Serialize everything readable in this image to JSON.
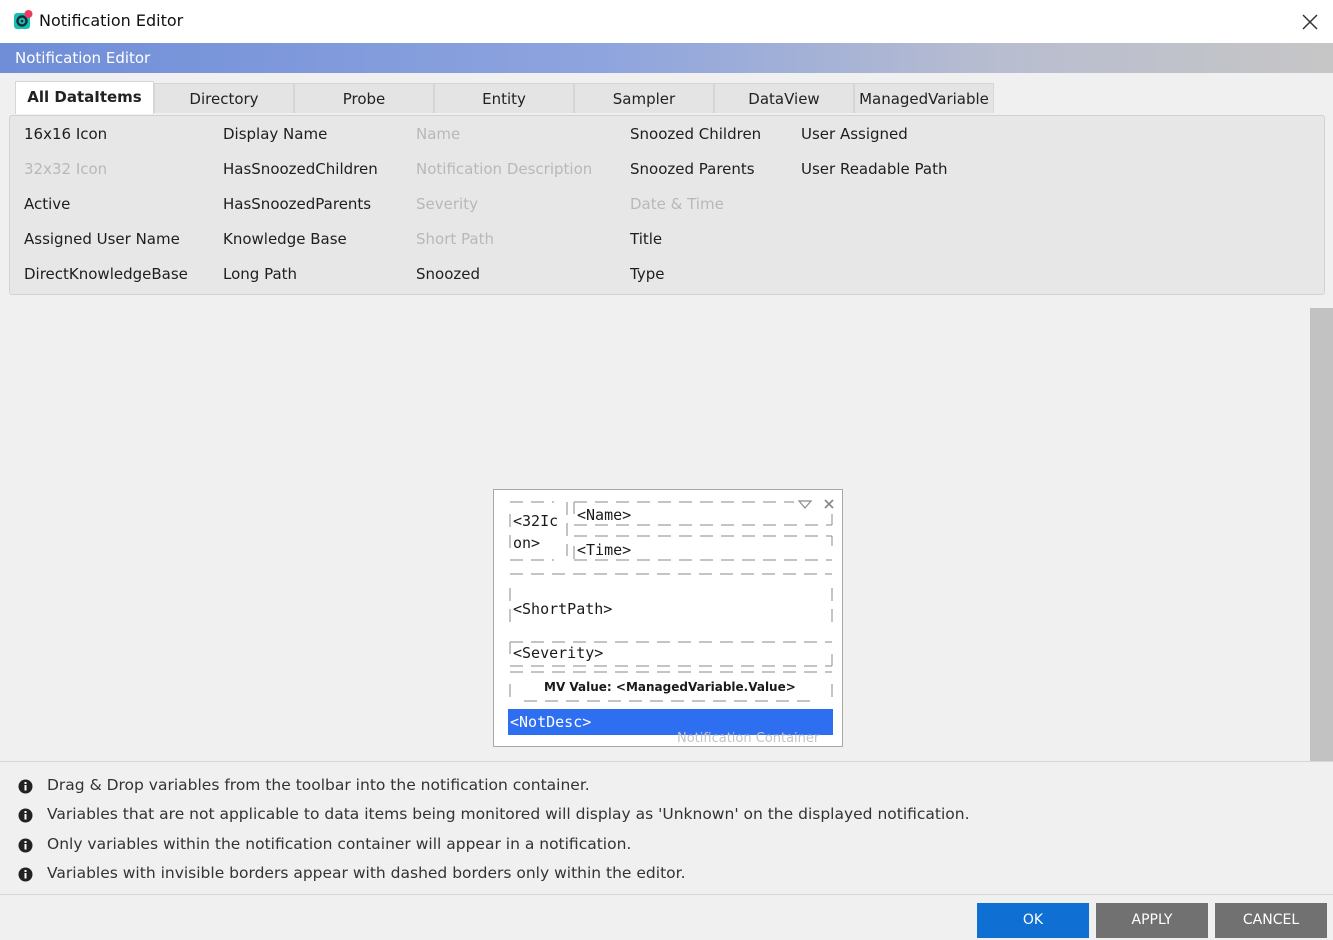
{
  "window": {
    "title": "Notification Editor"
  },
  "header": {
    "title": "Notification Editor"
  },
  "tabs": [
    {
      "label": "All DataItems",
      "active": true
    },
    {
      "label": "Directory"
    },
    {
      "label": "Probe"
    },
    {
      "label": "Entity"
    },
    {
      "label": "Sampler"
    },
    {
      "label": "DataView"
    },
    {
      "label": "ManagedVariable"
    }
  ],
  "items": {
    "col1": [
      "16x16 Icon",
      "32x32 Icon",
      "Active",
      "Assigned User Name",
      "DirectKnowledgeBase"
    ],
    "col2": [
      "Display Name",
      "HasSnoozedChildren",
      "HasSnoozedParents",
      "Knowledge Base",
      "Long Path"
    ],
    "col3": [
      "Name",
      "Notification Description",
      "Severity",
      "Short Path",
      "Snoozed"
    ],
    "col4": [
      "Snoozed Children",
      "Snoozed Parents",
      "Date & Time",
      "Title",
      "Type"
    ],
    "col5": [
      "User Assigned",
      "User Readable Path"
    ],
    "disabled": [
      "32x32 Icon",
      "Name",
      "Notification Description",
      "Severity",
      "Short Path",
      "Date & Time"
    ]
  },
  "container": {
    "label": "Notification Container",
    "icon_l1": "<32Ic",
    "icon_l2": "on>",
    "name": "<Name>",
    "time": "<Time>",
    "shortpath": "<ShortPath>",
    "severity": "<Severity>",
    "mv": "MV Value: <ManagedVariable.Value>",
    "notdesc": "<NotDesc>"
  },
  "info": [
    "Drag & Drop variables from the toolbar into the notification container.",
    "Variables that are not applicable to data items being monitored will display as 'Unknown' on the displayed notification.",
    "Only variables within the notification container will appear in a notification.",
    "Variables with invisible borders appear with dashed borders only within the editor."
  ],
  "footer": {
    "ok": "OK",
    "apply": "APPLY",
    "cancel": "CANCEL"
  },
  "colors": {
    "accent": "#0f6fd2",
    "selected": "#2e6ff2",
    "secondary_button": "#717171"
  }
}
